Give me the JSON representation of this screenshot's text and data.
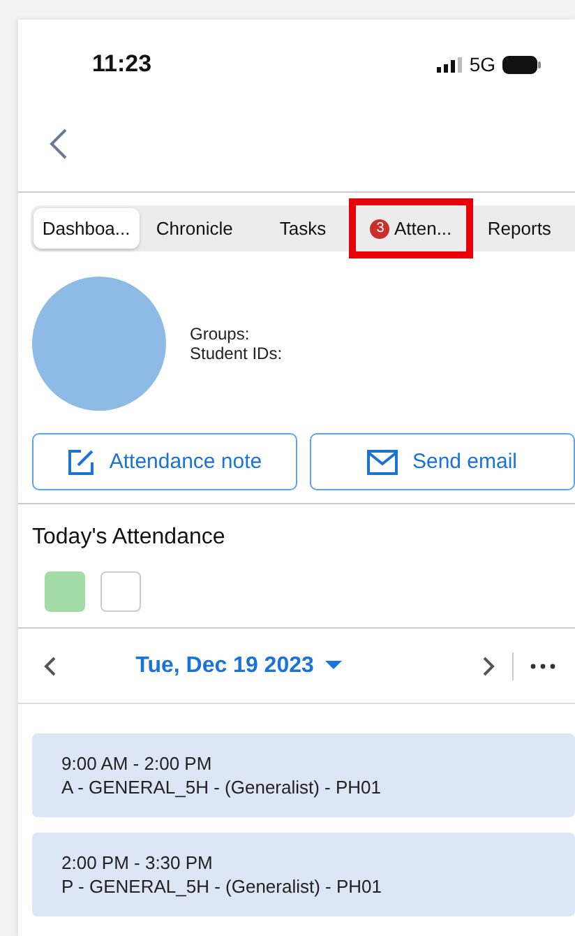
{
  "status_bar": {
    "time": "11:23",
    "network": "5G"
  },
  "tabs": [
    {
      "label": "Dashboa...",
      "selected": true,
      "highlighted": false
    },
    {
      "label": "Chronicle",
      "selected": false,
      "highlighted": false
    },
    {
      "label": "Tasks",
      "selected": false,
      "highlighted": false
    },
    {
      "label": "Atten...",
      "selected": false,
      "highlighted": true,
      "badge": "3"
    },
    {
      "label": "Reports",
      "selected": false,
      "highlighted": false
    }
  ],
  "profile": {
    "fields": [
      "Groups:",
      "Student IDs:"
    ]
  },
  "actions": [
    {
      "kind": "note",
      "label": "Attendance note"
    },
    {
      "kind": "email",
      "label": "Send email"
    }
  ],
  "attendance": {
    "title": "Today's Attendance",
    "squares": [
      {
        "color": "#a3dca6"
      },
      {
        "color": "#ffffff"
      }
    ]
  },
  "date_nav": {
    "date": "Tue, Dec 19 2023"
  },
  "sessions": [
    {
      "time": "9:00 AM - 2:00 PM",
      "detail": "A - GENERAL_5H - (Generalist) - PH01"
    },
    {
      "time": "2:00 PM - 3:30 PM",
      "detail": "P - GENERAL_5H - (Generalist) - PH01"
    }
  ]
}
